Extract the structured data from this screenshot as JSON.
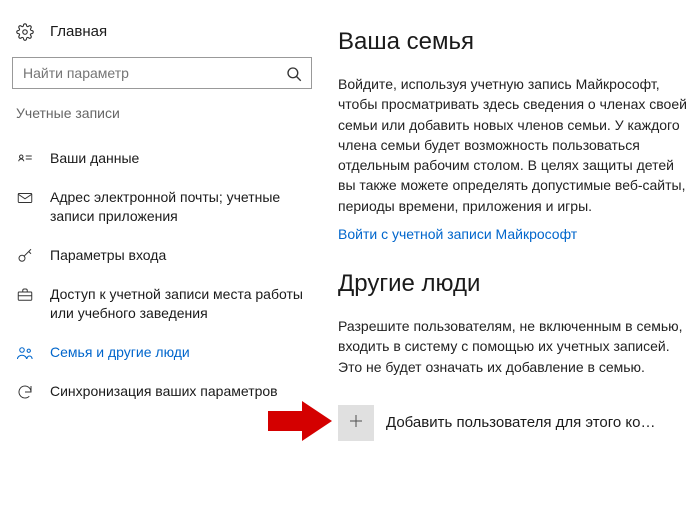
{
  "sidebar": {
    "home_label": "Главная",
    "search_placeholder": "Найти параметр",
    "section_label": "Учетные записи",
    "items": [
      {
        "label": "Ваши данные"
      },
      {
        "label": "Адрес электронной почты; учетные записи приложения"
      },
      {
        "label": "Параметры входа"
      },
      {
        "label": "Доступ к учетной записи места работы или учебного заведения"
      },
      {
        "label": "Семья и другие люди"
      },
      {
        "label": "Синхронизация ваших параметров"
      }
    ]
  },
  "content": {
    "family_heading": "Ваша семья",
    "family_text": "Войдите, используя учетную запись Майкрософт, чтобы просматривать здесь сведения о членах своей семьи или добавить новых членов семьи. У каждого члена семьи будет возможность пользоваться отдельным рабочим столом. В целях защиты детей вы также можете определять допустимые веб-сайты, периоды времени, приложения и игры.",
    "family_link": "Войти с учетной записи Майкрософт",
    "others_heading": "Другие люди",
    "others_text": "Разрешите пользователям, не включенным в семью, входить в систему с помощью их учетных записей. Это не будет означать их добавление в семью.",
    "add_user_label": "Добавить пользователя для этого компь…"
  }
}
